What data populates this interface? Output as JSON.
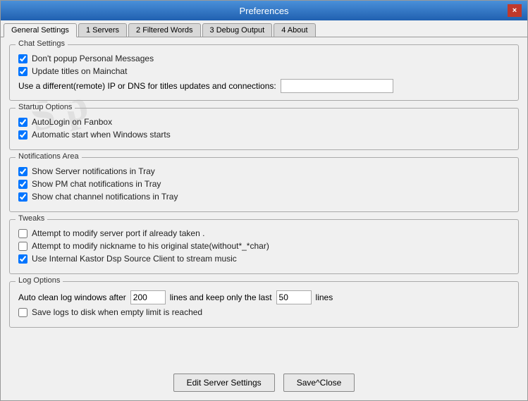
{
  "window": {
    "title": "Preferences",
    "close_label": "×"
  },
  "tabs": [
    {
      "label": "General Settings",
      "active": true
    },
    {
      "label": "1 Servers",
      "active": false
    },
    {
      "label": "2 Filtered Words",
      "active": false
    },
    {
      "label": "3 Debug Output",
      "active": false
    },
    {
      "label": "4 About",
      "active": false
    }
  ],
  "chat_settings": {
    "group_label": "Chat Settings",
    "checkbox1_label": "Don't popup Personal Messages",
    "checkbox1_checked": true,
    "checkbox2_label": "Update titles on Mainchat",
    "checkbox2_checked": true,
    "ip_label": "Use a different(remote) IP or DNS  for titles updates and connections:",
    "ip_value": ""
  },
  "startup_options": {
    "group_label": "Startup Options",
    "checkbox1_label": "AutoLogin on Fanbox",
    "checkbox1_checked": true,
    "checkbox2_label": "Automatic start when Windows starts",
    "checkbox2_checked": true
  },
  "notifications_area": {
    "group_label": "Notifications Area",
    "checkbox1_label": "Show Server notifications in Tray",
    "checkbox1_checked": true,
    "checkbox2_label": "Show PM chat notifications in Tray",
    "checkbox2_checked": true,
    "checkbox3_label": "Show chat channel notifications in Tray",
    "checkbox3_checked": true
  },
  "tweaks": {
    "group_label": "Tweaks",
    "checkbox1_label": "Attempt to modify server  port if already taken .",
    "checkbox1_checked": false,
    "checkbox2_label": "Attempt to modify nickname to his original  state(without*_*char)",
    "checkbox2_checked": false,
    "checkbox3_label": "Use Internal Kastor Dsp Source Client to stream music",
    "checkbox3_checked": true
  },
  "log_options": {
    "group_label": "Log Options",
    "log_prefix": "Auto clean log windows after",
    "log_value1": "200",
    "log_middle": "lines  and keep only the last",
    "log_value2": "50",
    "log_suffix": "lines",
    "checkbox_label": "Save logs to disk when empty limit is reached",
    "checkbox_checked": false
  },
  "footer": {
    "edit_server_label": "Edit Server Settings",
    "save_close_label": "Save^Close"
  },
  "watermark": "S p"
}
